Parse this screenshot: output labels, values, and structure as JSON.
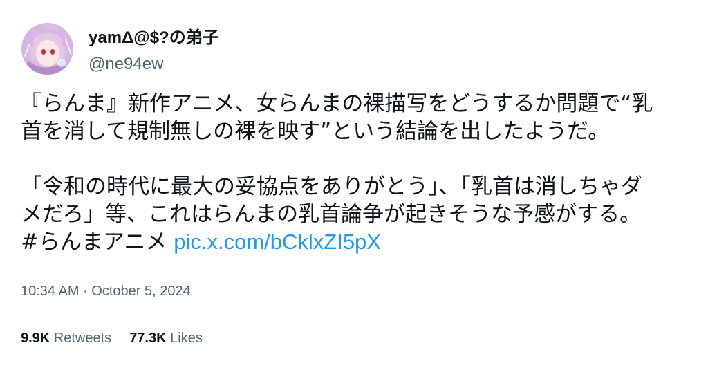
{
  "author": {
    "display_name": "yamΔ@$?の弟子",
    "handle": "@ne94ew"
  },
  "tweet": {
    "line1": "『らんま』新作アニメ、女らんまの裸描写をどうするか問題で“乳",
    "line2": "首を消して規制無しの裸を映す”という結論を出したようだ。",
    "line3": "「令和の時代に最大の妥協点をありがとう」、「乳首は消しちゃダ",
    "line4": "メだろ」等、これはらんまの乳首論争が起きそうな予感がする。",
    "hashtag": "#らんまアニメ",
    "link": "pic.x.com/bCklxZI5pX"
  },
  "timestamp": "10:34 AM · October 5, 2024",
  "stats": {
    "retweets_count": "9.9K",
    "retweets_label": "Retweets",
    "likes_count": "77.3K",
    "likes_label": "Likes"
  },
  "colors": {
    "link": "#1d9bf0",
    "secondary_text": "#536471",
    "primary_text": "#0f1419"
  },
  "icons": {
    "avatar": "avatar-image"
  }
}
